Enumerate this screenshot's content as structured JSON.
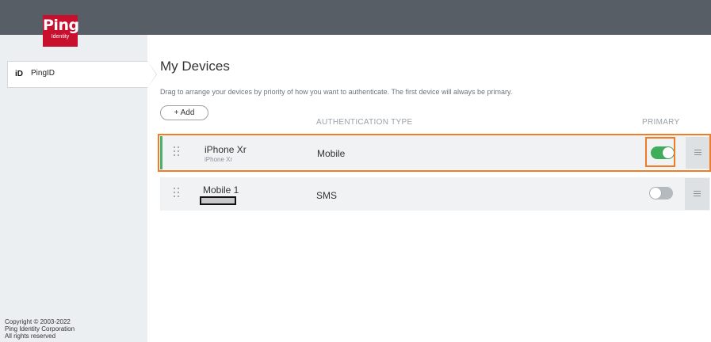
{
  "header": {
    "logo_text": "Ping",
    "logo_subtext": "Identity"
  },
  "sidebar": {
    "items": [
      {
        "icon": "id-icon",
        "icon_text": "iD",
        "label": "PingID"
      }
    ],
    "copyright": [
      "Copyright © 2003-2022",
      "Ping Identity Corporation",
      "All rights reserved"
    ]
  },
  "main": {
    "title": "My Devices",
    "description": "Drag to arrange your devices by priority of how you want to authenticate. The first device will always be primary.",
    "add_button": "+ Add",
    "columns": {
      "auth_type": "AUTHENTICATION TYPE",
      "primary": "PRIMARY"
    },
    "devices": [
      {
        "name": "iPhone Xr",
        "subname": "iPhone Xr",
        "type": "Mobile",
        "primary": true
      },
      {
        "name": "Mobile 1",
        "subname": "",
        "type": "SMS",
        "primary": false
      }
    ]
  },
  "colors": {
    "brand": "#c8102e",
    "toggle_on": "#3fae5a",
    "toggle_off": "#b5babf",
    "highlight": "#f07d26",
    "topbar": "#575e66"
  }
}
